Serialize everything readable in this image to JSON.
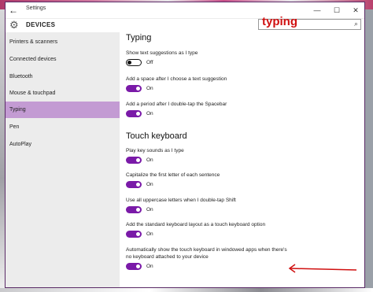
{
  "window": {
    "title": "Settings",
    "back": "←",
    "controls": {
      "minimize": "—",
      "maximize": "☐",
      "close": "✕"
    }
  },
  "header": {
    "title": "DEVICES",
    "gear": "⚙",
    "search": {
      "value": "typing",
      "icon": "⌕"
    }
  },
  "sidebar": {
    "items": [
      {
        "label": "Printers & scanners",
        "selected": false
      },
      {
        "label": "Connected devices",
        "selected": false
      },
      {
        "label": "Bluetooth",
        "selected": false
      },
      {
        "label": "Mouse & touchpad",
        "selected": false
      },
      {
        "label": "Typing",
        "selected": true
      },
      {
        "label": "Pen",
        "selected": false
      },
      {
        "label": "AutoPlay",
        "selected": false
      }
    ]
  },
  "sections": {
    "typing": {
      "title": "Typing",
      "settings": [
        {
          "label": "Show text suggestions as I type",
          "state": "Off"
        },
        {
          "label": "Add a space after I choose a text suggestion",
          "state": "On"
        },
        {
          "label": "Add a period after I double-tap the Spacebar",
          "state": "On"
        }
      ]
    },
    "touch_keyboard": {
      "title": "Touch keyboard",
      "settings": [
        {
          "label": "Play key sounds as I type",
          "state": "On"
        },
        {
          "label": "Capitalize the first letter of each sentence",
          "state": "On"
        },
        {
          "label": "Use all uppercase letters when I double-tap Shift",
          "state": "On"
        },
        {
          "label": "Add the standard keyboard layout as a touch keyboard option",
          "state": "On"
        },
        {
          "label": "Automatically show the touch keyboard in windowed apps when there's no keyboard attached to your device",
          "state": "On"
        }
      ]
    }
  },
  "colors": {
    "accent": "#7a1aa8",
    "selected_nav": "#c39bd3",
    "annotation": "#d01010"
  }
}
